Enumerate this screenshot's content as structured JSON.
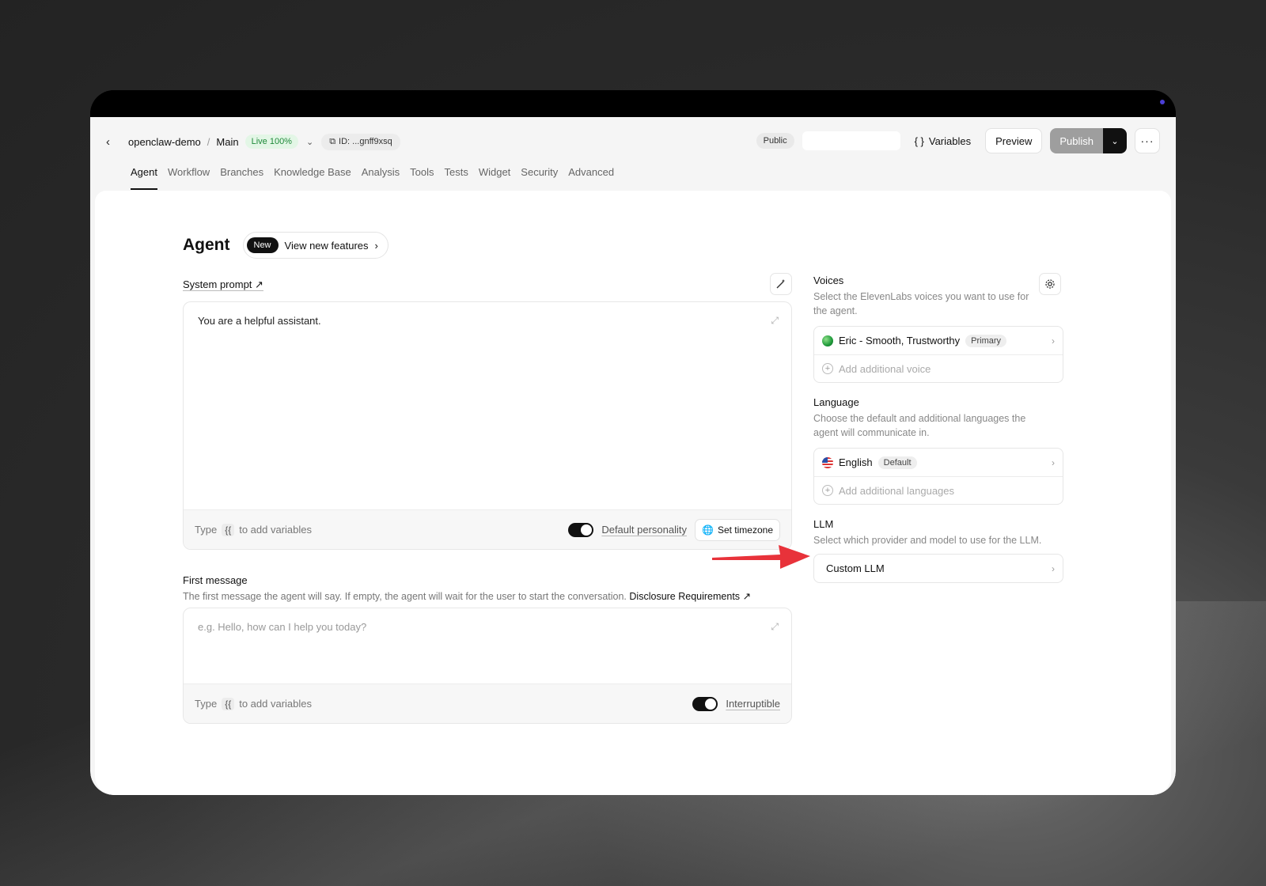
{
  "header": {
    "project": "openclaw-demo",
    "branch": "Main",
    "live_badge": "Live 100%",
    "id_label": "ID: ...gnff9xsq",
    "public_badge": "Public",
    "variables_label": "Variables",
    "preview_label": "Preview",
    "publish_label": "Publish"
  },
  "tabs": [
    "Agent",
    "Workflow",
    "Branches",
    "Knowledge Base",
    "Analysis",
    "Tools",
    "Tests",
    "Widget",
    "Security",
    "Advanced"
  ],
  "page": {
    "title": "Agent",
    "new_badge": "New",
    "features_label": "View new features"
  },
  "system_prompt": {
    "label": "System prompt ↗",
    "value": "You are a helpful assistant.",
    "hint_type": "Type",
    "hint_brace": "{{",
    "hint_rest": "to add variables",
    "toggle_label": "Default personality",
    "timezone_label": "Set timezone"
  },
  "first_message": {
    "label": "First message",
    "description": "The first message the agent will say. If empty, the agent will wait for the user to start the conversation.",
    "disclosure_link": "Disclosure Requirements ↗",
    "placeholder": "e.g. Hello, how can I help you today?",
    "hint_type": "Type",
    "hint_brace": "{{",
    "hint_rest": "to add variables",
    "toggle_label": "Interruptible"
  },
  "voices": {
    "title": "Voices",
    "description": "Select the ElevenLabs voices you want to use for the agent.",
    "primary_voice": "Eric - Smooth, Trustworthy",
    "primary_badge": "Primary",
    "add_label": "Add additional voice"
  },
  "language": {
    "title": "Language",
    "description": "Choose the default and additional languages the agent will communicate in.",
    "default_language": "English",
    "default_badge": "Default",
    "add_label": "Add additional languages"
  },
  "llm": {
    "title": "LLM",
    "description": "Select which provider and model to use for the LLM.",
    "selected": "Custom LLM"
  },
  "colors": {
    "annotation_arrow": "#e8323a",
    "live_green": "#1f8a3a",
    "publish_disabled": "#9e9e9e"
  }
}
